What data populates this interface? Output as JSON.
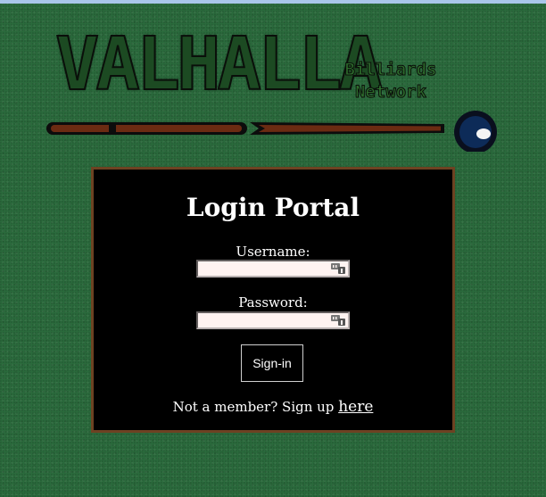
{
  "logo": {
    "wordmark": "VALHALLA",
    "sub_line1": "Billiards",
    "sub_line2": "Network"
  },
  "login": {
    "title": "Login Portal",
    "username_label": "Username:",
    "username_value": "",
    "password_label": "Password:",
    "password_value": "",
    "signin_label": "Sign-in",
    "footer_text": "Not a member? Sign up ",
    "footer_link": "here"
  },
  "colors": {
    "background": "#2a6a3c",
    "panel": "#000000",
    "panel_border": "#6d4222",
    "field_bg": "#fff3f1"
  },
  "icons": {
    "field_icon": "password-manager-key-icon"
  }
}
